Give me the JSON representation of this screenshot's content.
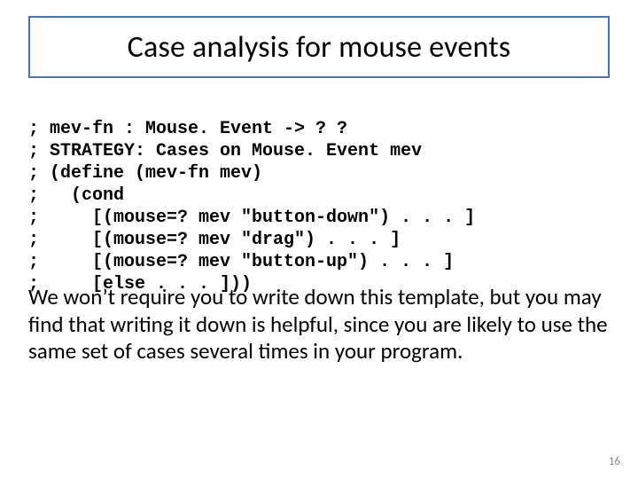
{
  "slide": {
    "title": "Case analysis for mouse events",
    "code_lines": [
      "; mev-fn : Mouse. Event -> ? ?",
      "; STRATEGY: Cases on Mouse. Event mev",
      "; (define (mev-fn mev)",
      ";   (cond",
      ";     [(mouse=? mev \"button-down\") . . . ]",
      ";     [(mouse=? mev \"drag\") . . . ]",
      ";     [(mouse=? mev \"button-up\") . . . ]",
      ";     [else . . . ]))"
    ],
    "body": "We won’t require you to write down this template, but you may find that writing it down is helpful, since you are likely to use the same set of cases several times in your program.",
    "page_number": "16"
  }
}
